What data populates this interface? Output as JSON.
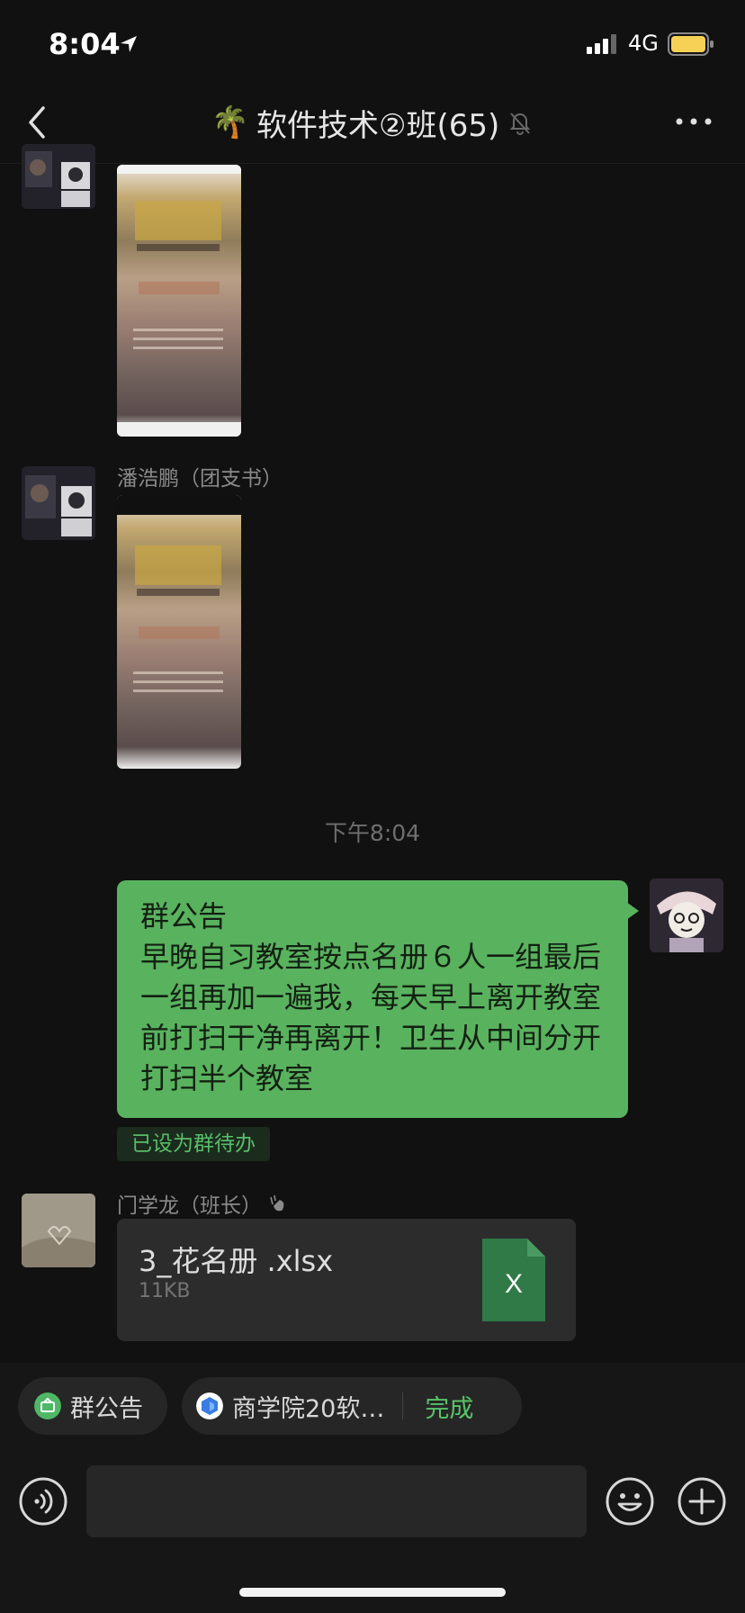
{
  "status_bar": {
    "time": "8:04",
    "network": "4G",
    "battery_color": "#f7d155"
  },
  "nav": {
    "title_emoji": "🌴",
    "title": "软件技术②班(65)",
    "icons": [
      "back-icon",
      "mute-bell-icon",
      "more-icon"
    ]
  },
  "messages": {
    "sender_b": "潘浩鹏（团支书）",
    "time_separator": "下午8:04",
    "notice": {
      "title": "群公告",
      "body": "早晚自习教室按点名册６人一组最后一组再加一遍我，每天早上离开教室前打扫干净再离开！卫生从中间分开打扫半个教室"
    },
    "todo_tag": "已设为群待办",
    "sender_d": "门学龙（班长）",
    "file": {
      "name": "3_花名册 .xlsx",
      "size": "11KB",
      "icon_letter": "X",
      "icon_color": "#2f7a46"
    }
  },
  "bottom": {
    "chip_announcement": "群公告",
    "chip_mini_app": "商学院20软…",
    "chip_done": "完成",
    "accent": "#57c468"
  }
}
